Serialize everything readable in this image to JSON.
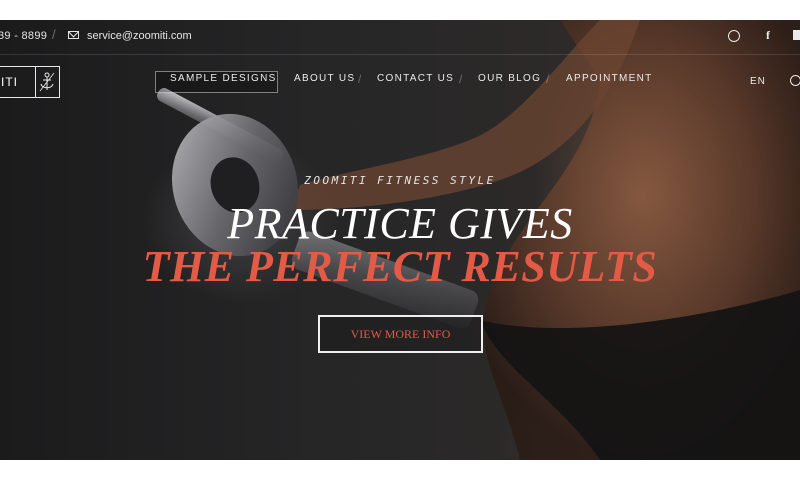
{
  "topbar": {
    "phone": "39 - 8899",
    "email": "service@zoomiti.com",
    "social_icons": [
      "dribbble-icon",
      "facebook-icon",
      "social-icon"
    ]
  },
  "logo": {
    "text": "ITI",
    "icon": "anchor-icon"
  },
  "nav": {
    "items": [
      {
        "label": "Sample Designs",
        "active": true
      },
      {
        "label": "About Us"
      },
      {
        "label": "Contact Us"
      },
      {
        "label": "Our Blog"
      },
      {
        "label": "Appointment"
      }
    ],
    "language": "EN"
  },
  "hero": {
    "tagline": "ZOOMITI FITNESS STYLE",
    "headline_line1": "PRACTICE GIVES",
    "headline_line2": "THE PERFECT RESULTS",
    "cta_label": "View More Info"
  },
  "colors": {
    "accent": "#e35a47",
    "text_light": "#eaeaea",
    "background_dark": "#1e1e1f"
  }
}
